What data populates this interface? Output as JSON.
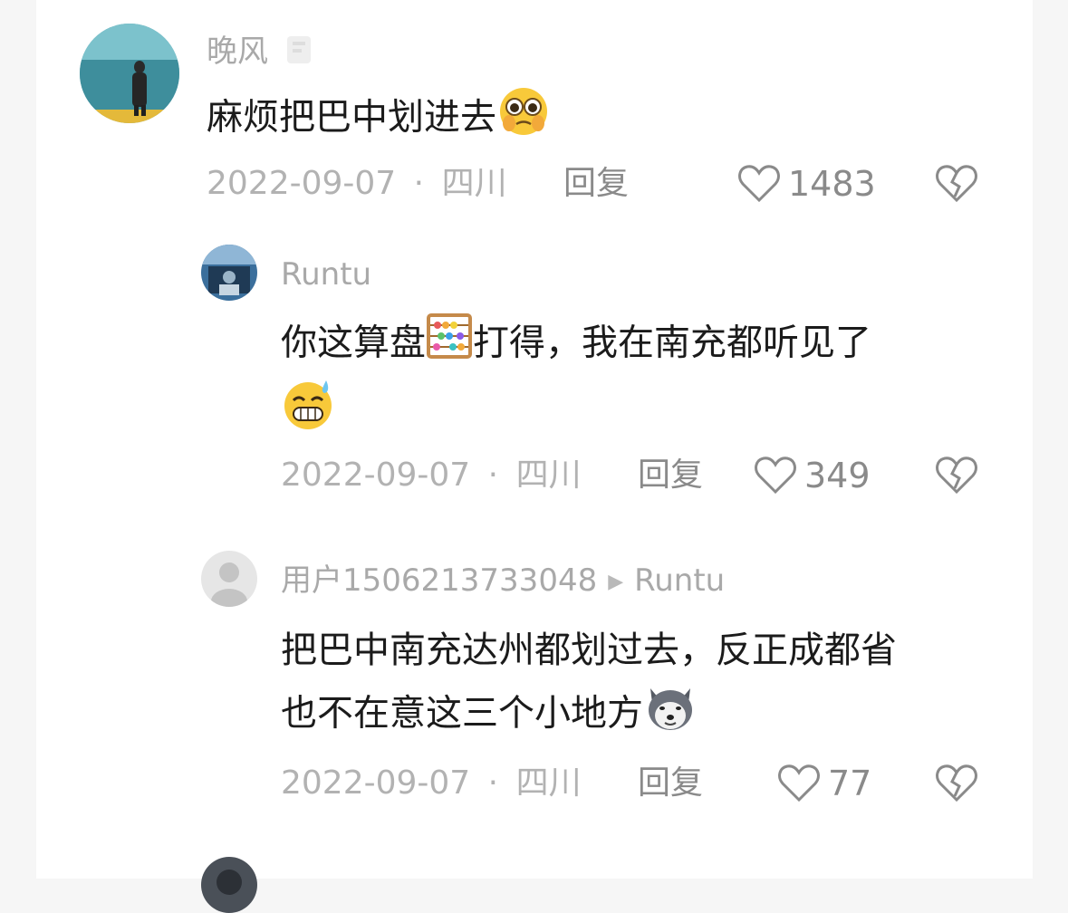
{
  "comments": [
    {
      "user": "晚风",
      "text": "麻烦把巴中划进去",
      "emoji": "pleading-face",
      "date": "2022-09-07",
      "dot": "·",
      "region": "四川",
      "reply_label": "回复",
      "likes": "1483"
    },
    {
      "user": "Runtu",
      "text_a": "你这算盘",
      "text_b": "打得，我在南充都听见了",
      "emoji_1": "abacus",
      "emoji_2": "grinning-sweat-face",
      "date": "2022-09-07",
      "dot": "·",
      "region": "四川",
      "reply_label": "回复",
      "likes": "349"
    },
    {
      "user": "用户1506213733048",
      "reply_to": "Runtu",
      "text_line1": "把巴中南充达州都划过去，反正成都省",
      "text_line2": "也不在意这三个小地方",
      "emoji": "husky-dog",
      "date": "2022-09-07",
      "dot": "·",
      "region": "四川",
      "reply_label": "回复",
      "likes": "77"
    }
  ],
  "colors": {
    "username": "#a9a9a9",
    "content": "#1b1b1b",
    "meta": "#b2b2b2",
    "action": "#8a8a8a"
  }
}
